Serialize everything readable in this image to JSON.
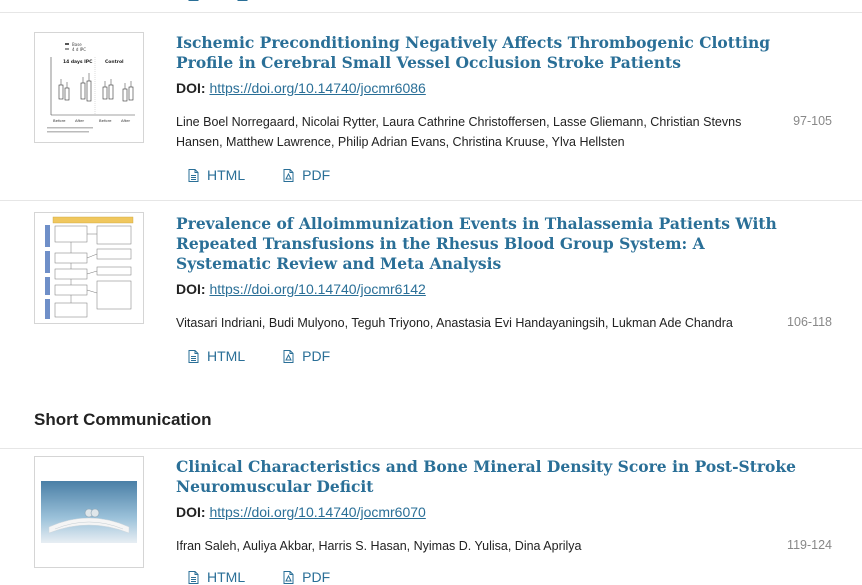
{
  "articles": [
    {
      "title": "Ischemic Preconditioning Negatively Affects Thrombogenic Clotting Profile in Cerebral Small Vessel Occlusion Stroke Patients",
      "doi_label": "DOI:",
      "doi_url": "https://doi.org/10.14740/jocmr6086",
      "authors": "Line Boel Norregaard, Nicolai Rytter, Laura Cathrine Christoffersen, Lasse Gliemann, Christian Stevns Hansen, Matthew Lawrence, Philip Adrian Evans, Christina Kruuse, Ylva Hellsten",
      "pages": "97-105",
      "html_label": "HTML",
      "pdf_label": "PDF",
      "thumb_text": {
        "legend_a": "Base",
        "legend_b": "4 d IPC",
        "group_a": "14 days IPC",
        "group_b": "Control",
        "x_labels": [
          "Before",
          "After",
          "Before",
          "After"
        ]
      }
    },
    {
      "title": "Prevalence of Alloimmunization Events in Thalassemia Patients With Repeated Transfusions in the Rhesus Blood Group System: A Systematic Review and Meta Analysis",
      "doi_label": "DOI:",
      "doi_url": "https://doi.org/10.14740/jocmr6142",
      "authors": "Vitasari Indriani, Budi Mulyono, Teguh Triyono, Anastasia Evi Handayaningsih, Lukman Ade Chandra",
      "pages": "106-118",
      "html_label": "HTML",
      "pdf_label": "PDF"
    },
    {
      "title": "Clinical Characteristics and Bone Mineral Density Score in Post-Stroke Neuromuscular Deficit",
      "doi_label": "DOI:",
      "doi_url": "https://doi.org/10.14740/jocmr6070",
      "authors": "Ifran Saleh, Auliya Akbar, Harris S. Hasan, Nyimas D. Yulisa, Dina Aprilya",
      "pages": "119-124",
      "html_label": "HTML",
      "pdf_label": "PDF"
    }
  ],
  "section": {
    "title": "Short Communication"
  },
  "colors": {
    "link": "#2a6f97",
    "text": "#222222",
    "muted": "#888888",
    "divider": "#e6e6e6"
  }
}
